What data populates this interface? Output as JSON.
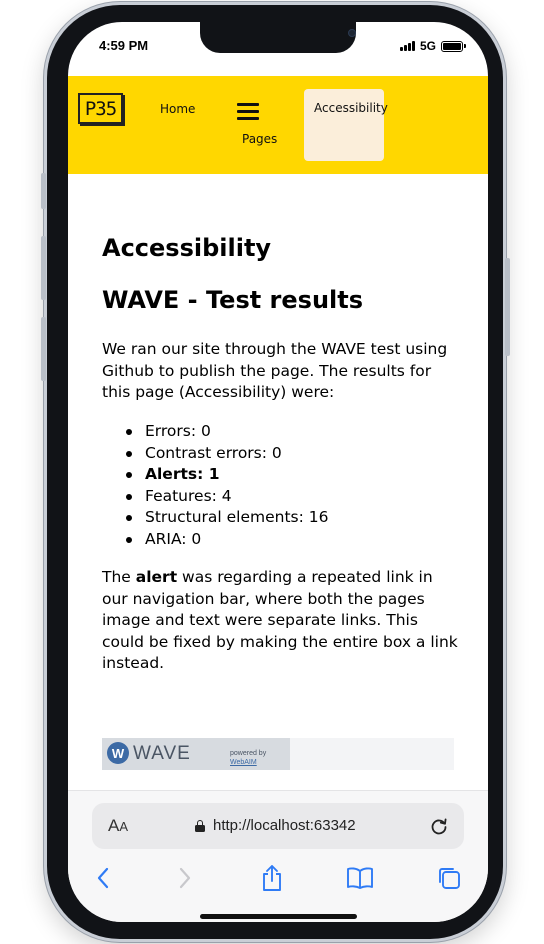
{
  "status_bar": {
    "time": "4:59 PM",
    "network": "5G",
    "battery_level": 1.0
  },
  "site_header": {
    "logo_text": "P35",
    "nav": {
      "home": "Home",
      "pages": "Pages",
      "accessibility": "Accessibility"
    },
    "background_color": "#ffd700",
    "active_tab_color": "#fbeeda"
  },
  "main": {
    "title": "Accessibility",
    "subtitle": "WAVE - Test results",
    "intro_lines": [
      "We ran our site through the WAVE test using",
      "Github to publish the page. The results for",
      "this page (Accessibility) were:"
    ],
    "results": [
      {
        "label": "Errors: 0",
        "bold": false
      },
      {
        "label": "Contrast errors: 0",
        "bold": false
      },
      {
        "label": "Alerts: 1",
        "bold": true
      },
      {
        "label": "Features: 4",
        "bold": false
      },
      {
        "label": "Structural elements: 16",
        "bold": false
      },
      {
        "label": "ARIA: 0",
        "bold": false
      }
    ],
    "note": {
      "line1_pre": "The ",
      "line1_bold": "alert",
      "line1_post": " was regarding a repeated link in",
      "lines": [
        "our navigation bar, where both the pages",
        "image and text were separate links. This",
        "could be fixed by making the entire box a link",
        "instead."
      ]
    },
    "wave_badge": {
      "logo_letter": "W",
      "name": "WAVE",
      "powered": "powered by",
      "org": "WebAIM"
    }
  },
  "browser": {
    "text_size_label": "A",
    "text_size_label_large": "A",
    "url": "http://localhost:63342",
    "icons": [
      "back-icon",
      "forward-icon",
      "share-icon",
      "bookmarks-icon",
      "tabs-icon",
      "lock-icon",
      "reload-icon"
    ]
  }
}
